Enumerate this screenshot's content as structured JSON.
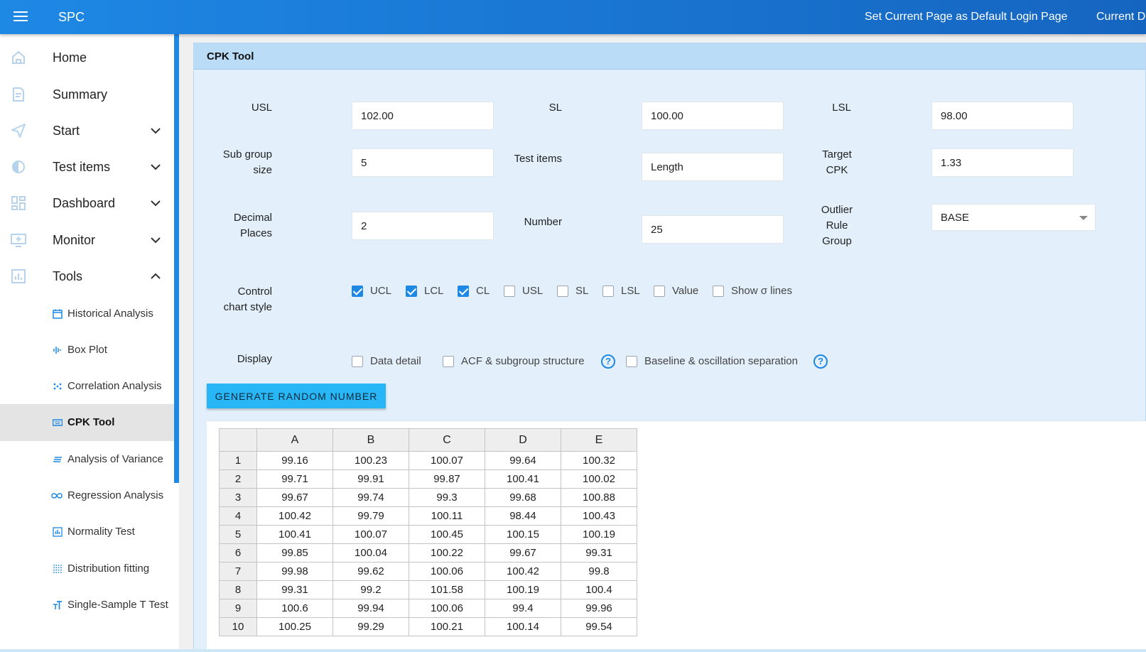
{
  "topbar": {
    "app_title": "SPC",
    "default_page_link": "Set Current Page as Default Login Page",
    "current_link": "Current De"
  },
  "sidebar": {
    "items": [
      {
        "label": "Home",
        "icon": "home-icon"
      },
      {
        "label": "Summary",
        "icon": "document-icon"
      },
      {
        "label": "Start",
        "icon": "send-icon"
      },
      {
        "label": "Test items",
        "icon": "drop-icon"
      },
      {
        "label": "Dashboard",
        "icon": "dashboard-icon"
      },
      {
        "label": "Monitor",
        "icon": "monitor-icon"
      },
      {
        "label": "Tools",
        "icon": "chart-icon"
      }
    ],
    "tools_subitems": [
      {
        "label": "Historical Analysis",
        "icon": "calendar-icon"
      },
      {
        "label": "Box Plot",
        "icon": "waveform-icon"
      },
      {
        "label": "Correlation Analysis",
        "icon": "scatter-icon"
      },
      {
        "label": "CPK Tool",
        "icon": "keyboard-icon"
      },
      {
        "label": "Analysis of Variance",
        "icon": "lines-icon"
      },
      {
        "label": "Regression Analysis",
        "icon": "infinity-icon"
      },
      {
        "label": "Normality Test",
        "icon": "bar-chart-icon"
      },
      {
        "label": "Distribution fitting",
        "icon": "dots-grid-icon"
      },
      {
        "label": "Single-Sample T Test",
        "icon": "text-size-icon"
      }
    ],
    "active_item": "CPK Tool"
  },
  "panel": {
    "title": "CPK Tool",
    "fields": {
      "usl": {
        "label": "USL",
        "value": "102.00"
      },
      "sl": {
        "label": "SL",
        "value": "100.00"
      },
      "lsl": {
        "label": "LSL",
        "value": "98.00"
      },
      "subgroup": {
        "label_line1": "Sub group",
        "label_line2": "size",
        "value": "5"
      },
      "test_items": {
        "label": "Test items",
        "value": "Length"
      },
      "target_cpk": {
        "label_line1": "Target",
        "label_line2": "CPK",
        "value": "1.33"
      },
      "decimal": {
        "label_line1": "Decimal",
        "label_line2": "Places",
        "value": "2"
      },
      "number": {
        "label": "Number",
        "value": "25"
      },
      "outlier": {
        "label_line1": "Outlier",
        "label_line2": "Rule",
        "label_line3": "Group",
        "value": "BASE"
      }
    },
    "control_chart": {
      "label_line1": "Control",
      "label_line2": "chart style",
      "options": [
        {
          "label": "UCL",
          "checked": true
        },
        {
          "label": "LCL",
          "checked": true
        },
        {
          "label": "CL",
          "checked": true
        },
        {
          "label": "USL",
          "checked": false
        },
        {
          "label": "SL",
          "checked": false
        },
        {
          "label": "LSL",
          "checked": false
        },
        {
          "label": "Value",
          "checked": false
        },
        {
          "label": "Show σ lines",
          "checked": false
        }
      ]
    },
    "display": {
      "label": "Display",
      "options": [
        {
          "label": "Data detail",
          "checked": false
        },
        {
          "label": "ACF & subgroup structure",
          "checked": false
        },
        {
          "label": "Baseline & oscillation separation",
          "checked": false
        }
      ],
      "help_glyph": "?"
    },
    "generate_button": "GENERATE RANDOM NUMBER"
  },
  "grid": {
    "columns": [
      "A",
      "B",
      "C",
      "D",
      "E"
    ],
    "rows": [
      {
        "n": "1",
        "cells": [
          "99.16",
          "100.23",
          "100.07",
          "99.64",
          "100.32"
        ]
      },
      {
        "n": "2",
        "cells": [
          "99.71",
          "99.91",
          "99.87",
          "100.41",
          "100.02"
        ]
      },
      {
        "n": "3",
        "cells": [
          "99.67",
          "99.74",
          "99.3",
          "99.68",
          "100.88"
        ]
      },
      {
        "n": "4",
        "cells": [
          "100.42",
          "99.79",
          "100.11",
          "98.44",
          "100.43"
        ]
      },
      {
        "n": "5",
        "cells": [
          "100.41",
          "100.07",
          "100.45",
          "100.15",
          "100.19"
        ]
      },
      {
        "n": "6",
        "cells": [
          "99.85",
          "100.04",
          "100.22",
          "99.67",
          "99.31"
        ]
      },
      {
        "n": "7",
        "cells": [
          "99.98",
          "99.62",
          "100.06",
          "100.42",
          "99.8"
        ]
      },
      {
        "n": "8",
        "cells": [
          "99.31",
          "99.2",
          "101.58",
          "100.19",
          "100.4"
        ]
      },
      {
        "n": "9",
        "cells": [
          "100.6",
          "99.94",
          "100.06",
          "99.4",
          "99.96"
        ]
      },
      {
        "n": "10",
        "cells": [
          "100.25",
          "99.29",
          "100.21",
          "100.14",
          "99.54"
        ]
      }
    ]
  },
  "colors": {
    "topbar": "#1e88e5",
    "accent": "#1e88e5",
    "button": "#29b6f6",
    "panel_bg": "#e3f0fb"
  }
}
